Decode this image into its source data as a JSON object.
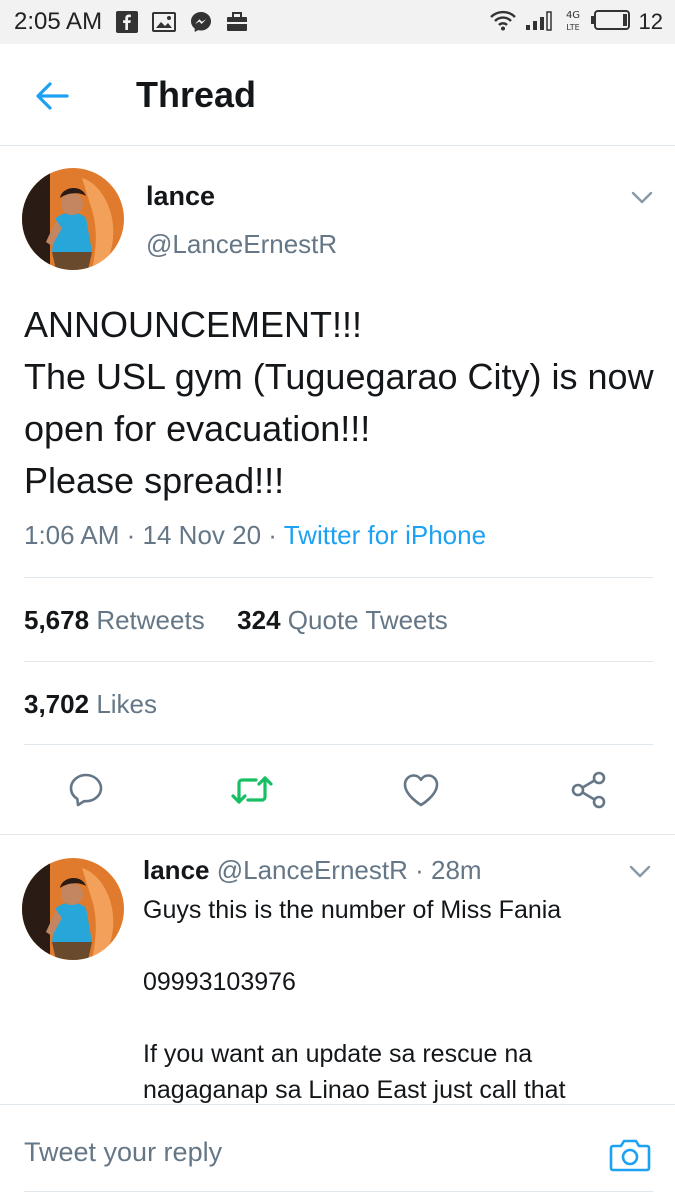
{
  "status_bar": {
    "time": "2:05 AM",
    "icons": [
      "facebook-icon",
      "gallery-icon",
      "messenger-icon",
      "briefcase-icon"
    ],
    "network": "4G LTE",
    "battery": "12"
  },
  "header": {
    "title": "Thread",
    "back_icon": "arrow-left-icon"
  },
  "tweet": {
    "name": "lance",
    "handle": "@LanceErnestR",
    "text": "ANNOUNCEMENT!!!\nThe USL gym (Tuguegarao City) is now open for evacuation!!!\nPlease spread!!!",
    "time": "1:06 AM",
    "date": "14 Nov 20",
    "source": "Twitter for iPhone",
    "retweets_count": "5,678",
    "retweets_label": "Retweets",
    "quotes_count": "324",
    "quotes_label": "Quote Tweets",
    "likes_count": "3,702",
    "likes_label": "Likes",
    "actions": [
      "reply-icon",
      "retweet-icon",
      "like-icon",
      "share-icon"
    ]
  },
  "reply": {
    "name": "lance",
    "handle": "@LanceErnestR",
    "age": "28m",
    "lines": [
      "Guys this is the number of Miss Fania",
      "09993103976",
      "If you want an update sa rescue na nagaganap sa Linao East just call that"
    ]
  },
  "compose": {
    "placeholder": "Tweet your reply",
    "camera_icon": "camera-icon"
  },
  "colors": {
    "accent": "#1da1f2",
    "retweet_green": "#17bf63",
    "secondary_text": "#657786",
    "primary_text": "#14171a",
    "divider": "#e1e8ed"
  }
}
